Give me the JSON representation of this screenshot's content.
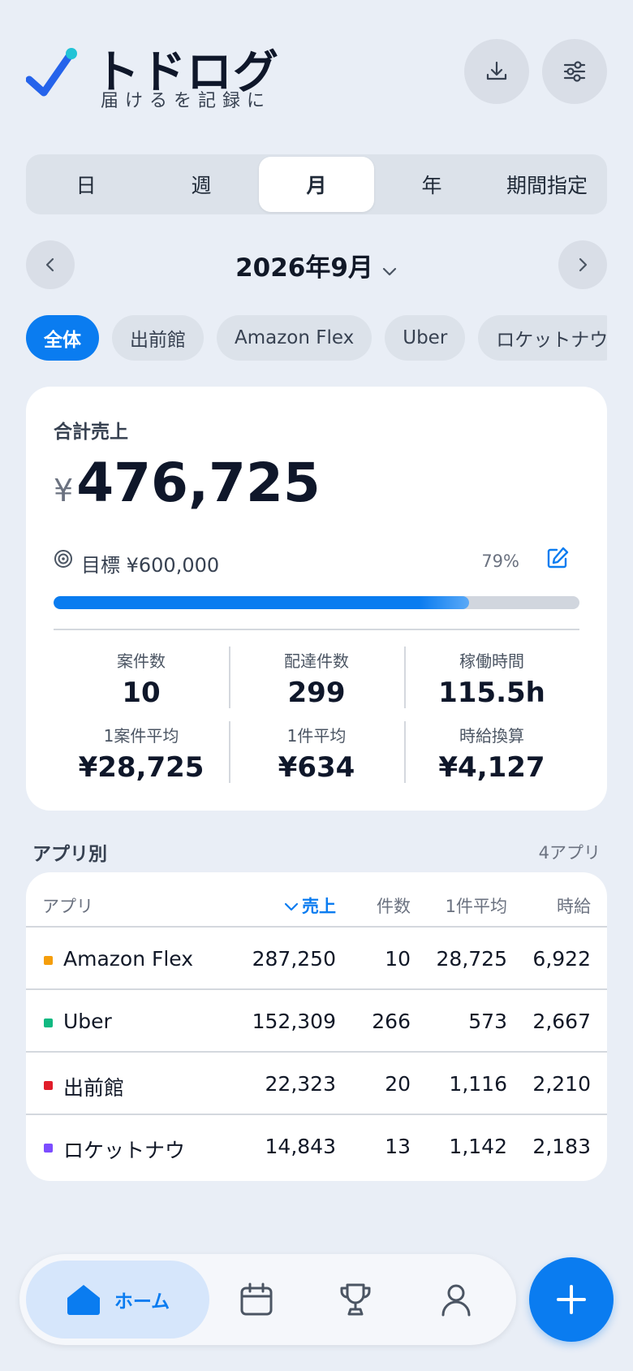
{
  "header": {
    "title": "トドログ",
    "subtitle": "届けるを記録に",
    "download_icon": "download-icon",
    "settings_icon": "sliders-icon"
  },
  "period_tabs": [
    {
      "label": "日",
      "active": false
    },
    {
      "label": "週",
      "active": false
    },
    {
      "label": "月",
      "active": true
    },
    {
      "label": "年",
      "active": false
    },
    {
      "label": "期間指定",
      "active": false
    }
  ],
  "month_nav": {
    "label": "2026年9月"
  },
  "chips": [
    {
      "label": "全体",
      "active": true
    },
    {
      "label": "出前館",
      "active": false
    },
    {
      "label": "Amazon Flex",
      "active": false
    },
    {
      "label": "Uber",
      "active": false
    },
    {
      "label": "ロケットナウ",
      "active": false
    }
  ],
  "summary": {
    "label": "合計売上",
    "currency": "¥",
    "total": "476,725",
    "goal_text": "目標 ¥600,000",
    "goal_percent_text": "79%",
    "progress": 0.79,
    "stats": [
      [
        {
          "label": "案件数",
          "value": "10"
        },
        {
          "label": "配達件数",
          "value": "299"
        },
        {
          "label": "稼働時間",
          "value": "115.5h"
        }
      ],
      [
        {
          "label": "1案件平均",
          "value": "¥28,725"
        },
        {
          "label": "1件平均",
          "value": "¥634"
        },
        {
          "label": "時給換算",
          "value": "¥4,127"
        }
      ]
    ]
  },
  "apps_section": {
    "title": "アプリ別",
    "count": "4アプリ",
    "columns": {
      "app": "アプリ",
      "sales": "売上",
      "count": "件数",
      "avg": "1件平均",
      "hourly": "時給"
    },
    "rows": [
      {
        "name": "Amazon Flex",
        "color": "#f59e0b",
        "sales": "287,250",
        "count": "10",
        "avg": "28,725",
        "hourly": "6,922"
      },
      {
        "name": "Uber",
        "color": "#10b981",
        "sales": "152,309",
        "count": "266",
        "avg": "573",
        "hourly": "2,667"
      },
      {
        "name": "出前館",
        "color": "#e11d2a",
        "sales": "22,323",
        "count": "20",
        "avg": "1,116",
        "hourly": "2,210"
      },
      {
        "name": "ロケットナウ",
        "color": "#7c4dff",
        "sales": "14,843",
        "count": "13",
        "avg": "1,142",
        "hourly": "2,183"
      }
    ]
  },
  "bottom_nav": {
    "home_label": "ホーム",
    "items": [
      "home-icon",
      "calendar-icon",
      "trophy-icon",
      "user-icon"
    ]
  },
  "colors": {
    "accent": "#0a7cf0",
    "background": "#e9eef6"
  }
}
